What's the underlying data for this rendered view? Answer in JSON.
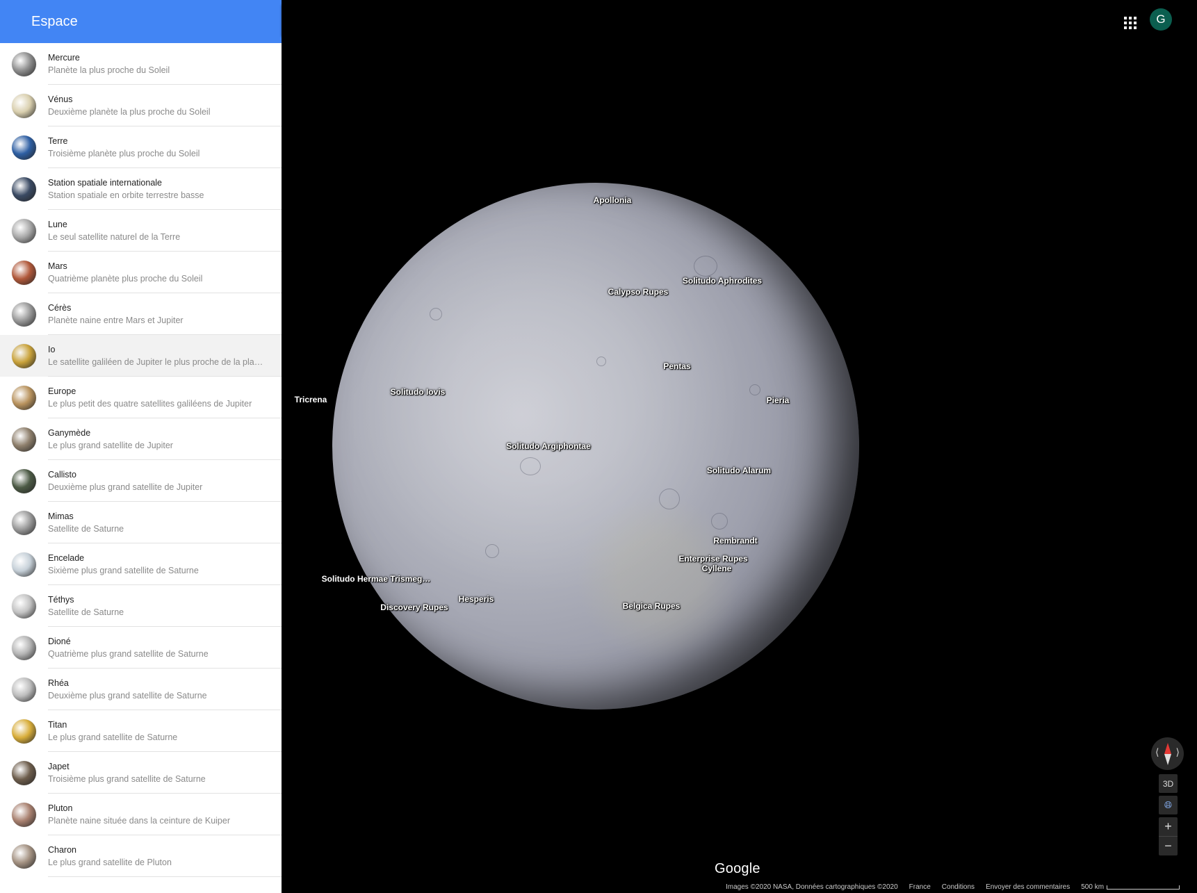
{
  "sidebar": {
    "title": "Espace",
    "items": [
      {
        "name": "Mercure",
        "desc": "Planète la plus proche du Soleil",
        "color": "#8f8f8f"
      },
      {
        "name": "Vénus",
        "desc": "Deuxième planète la plus proche du Soleil",
        "color": "#d9cfae"
      },
      {
        "name": "Terre",
        "desc": "Troisième planète plus proche du Soleil",
        "color": "#2e5fa3"
      },
      {
        "name": "Station spatiale internationale",
        "desc": "Station spatiale en orbite terrestre basse",
        "color": "#3a4a63"
      },
      {
        "name": "Lune",
        "desc": "Le seul satellite naturel de la Terre",
        "color": "#a9a9a9"
      },
      {
        "name": "Mars",
        "desc": "Quatrième planète plus proche du Soleil",
        "color": "#b0583a"
      },
      {
        "name": "Cérès",
        "desc": "Planète naine entre Mars et Jupiter",
        "color": "#9a9a9a"
      },
      {
        "name": "Io",
        "desc": "Le satellite galiléen de Jupiter le plus proche de la planète",
        "color": "#c9a23a"
      },
      {
        "name": "Europe",
        "desc": "Le plus petit des quatre satellites galiléens de Jupiter",
        "color": "#b9935e"
      },
      {
        "name": "Ganymède",
        "desc": "Le plus grand satellite de Jupiter",
        "color": "#8e7f6c"
      },
      {
        "name": "Callisto",
        "desc": "Deuxième plus grand satellite de Jupiter",
        "color": "#4c5a45"
      },
      {
        "name": "Mimas",
        "desc": "Satellite de Saturne",
        "color": "#9c9c9c"
      },
      {
        "name": "Encelade",
        "desc": "Sixième plus grand satellite de Saturne",
        "color": "#c6d0d8"
      },
      {
        "name": "Téthys",
        "desc": "Satellite de Saturne",
        "color": "#c3c3c3"
      },
      {
        "name": "Dioné",
        "desc": "Quatrième plus grand satellite de Saturne",
        "color": "#b4b4b4"
      },
      {
        "name": "Rhéa",
        "desc": "Deuxième plus grand satellite de Saturne",
        "color": "#bdbdbd"
      },
      {
        "name": "Titan",
        "desc": "Le plus grand satellite de Saturne",
        "color": "#d8ad3a"
      },
      {
        "name": "Japet",
        "desc": "Troisième plus grand satellite de Saturne",
        "color": "#6d5d4c"
      },
      {
        "name": "Pluton",
        "desc": "Planète naine située dans la ceinture de Kuiper",
        "color": "#a8806f"
      },
      {
        "name": "Charon",
        "desc": "Le plus grand satellite de Pluton",
        "color": "#a49282"
      }
    ],
    "selected_index": 7
  },
  "header": {
    "avatar_letter": "G",
    "apps_icon": "apps-grid-icon"
  },
  "map": {
    "labels": [
      {
        "text": "Apollonia"
      },
      {
        "text": "Solitudo Aphrodites"
      },
      {
        "text": "Calypso Rupes"
      },
      {
        "text": "Pentas"
      },
      {
        "text": "Tricrena"
      },
      {
        "text": "Solitudo Iovis"
      },
      {
        "text": "Pieria"
      },
      {
        "text": "Solitudo Argiphontae"
      },
      {
        "text": "Solitudo Alarum"
      },
      {
        "text": "Rembrandt"
      },
      {
        "text": "Enterprise Rupes"
      },
      {
        "text": "Cyllene"
      },
      {
        "text": "Solitudo Hermae Trismeg…"
      },
      {
        "text": "Hesperis"
      },
      {
        "text": "Discovery Rupes"
      },
      {
        "text": "Belgica Rupes"
      }
    ]
  },
  "controls": {
    "mode_3d_label": "3D",
    "zoom_in_label": "+",
    "zoom_out_label": "−"
  },
  "footer": {
    "logo": "Google",
    "credits": "Images ©2020 NASA, Données cartographiques ©2020",
    "country": "France",
    "terms": "Conditions",
    "feedback": "Envoyer des commentaires",
    "scale": "500 km"
  },
  "colors": {
    "header_blue": "#4285f4",
    "avatar_green": "#0b5e4f",
    "compass_red": "#e53935"
  }
}
